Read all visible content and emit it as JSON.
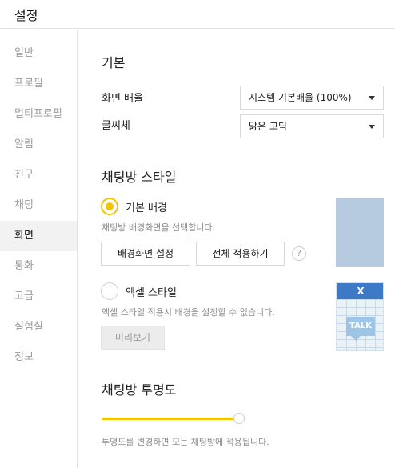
{
  "window": {
    "title": "설정"
  },
  "sidebar": {
    "items": [
      {
        "label": "일반",
        "active": false
      },
      {
        "label": "프로필",
        "active": false
      },
      {
        "label": "멀티프로필",
        "active": false
      },
      {
        "label": "알림",
        "active": false
      },
      {
        "label": "친구",
        "active": false
      },
      {
        "label": "채팅",
        "active": false
      },
      {
        "label": "화면",
        "active": true
      },
      {
        "label": "통화",
        "active": false
      },
      {
        "label": "고급",
        "active": false
      },
      {
        "label": "실험실",
        "active": false
      },
      {
        "label": "정보",
        "active": false
      }
    ]
  },
  "basic": {
    "title": "기본",
    "zoom_label": "화면 배율",
    "zoom_value": "시스템 기본배율 (100%)",
    "font_label": "글씨체",
    "font_value": "맑은 고딕"
  },
  "chatroom_style": {
    "title": "채팅방 스타일",
    "default_bg": {
      "label": "기본 배경",
      "selected": true,
      "description": "채팅방 배경화면을 선택합니다.",
      "set_bg_button": "배경화면 설정",
      "apply_all_button": "전체 적용하기",
      "help": "?"
    },
    "excel_style": {
      "label": "엑셀 스타일",
      "selected": false,
      "description": "엑셀 스타일 적용시 배경을 설정할 수 없습니다.",
      "preview_button": "미리보기",
      "thumb_x": "X",
      "thumb_talk": "TALK"
    }
  },
  "transparency": {
    "title": "채팅방 투명도",
    "value_percent": 100,
    "description": "투명도를 변경하면 모든 채팅방에 적용됩니다."
  },
  "colors": {
    "accent_yellow": "#f5c400",
    "thumb_blue": "#b7cbe0",
    "excel_blue": "#3e79c7"
  }
}
